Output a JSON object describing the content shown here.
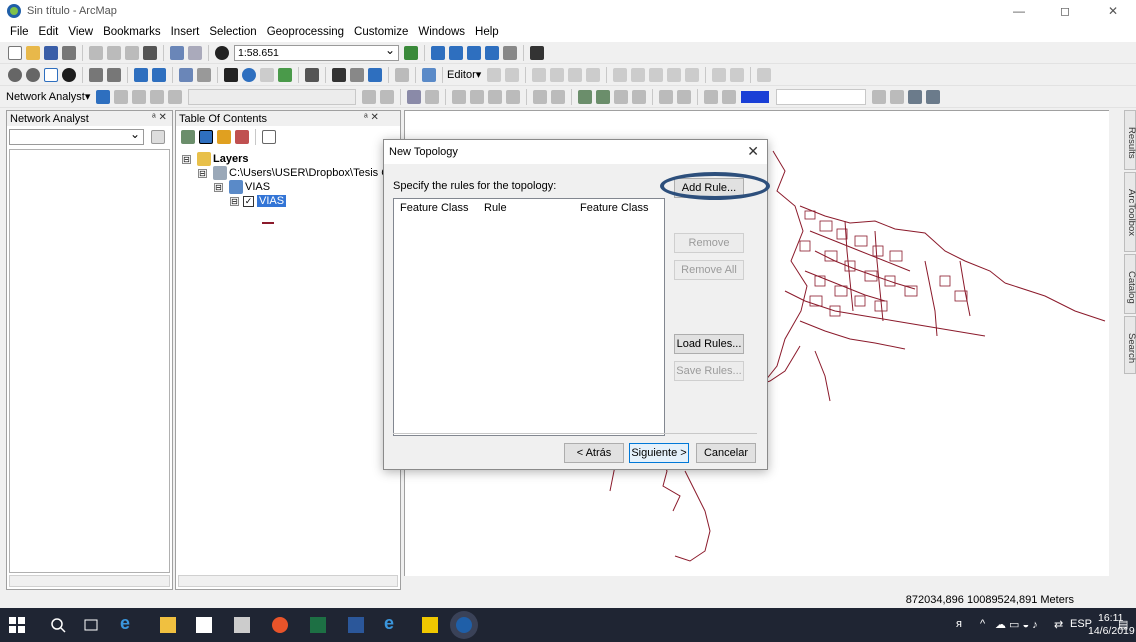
{
  "window": {
    "title": "Sin título - ArcMap",
    "controls": [
      "—",
      "◻",
      "✕"
    ]
  },
  "menu": [
    "File",
    "Edit",
    "View",
    "Bookmarks",
    "Insert",
    "Selection",
    "Geoprocessing",
    "Customize",
    "Windows",
    "Help"
  ],
  "toolbar": {
    "scale_value": "1:58.651",
    "editor_label": "Editor▾",
    "network_analyst_label": "Network Analyst▾"
  },
  "network_analyst_panel": {
    "title": "Network Analyst",
    "pin": "ᵃ ✕"
  },
  "toc": {
    "title": "Table Of Contents",
    "pin": "ᵃ ✕",
    "items": [
      {
        "label": "Layers",
        "expander": "⊟"
      },
      {
        "label": "C:\\Users\\USER\\Dropbox\\Tesis Casc",
        "expander": "⊟"
      },
      {
        "label": "VIAS",
        "expander": "⊟"
      },
      {
        "label": "VIAS",
        "expander": "⊟",
        "checked": "✓"
      }
    ]
  },
  "side_tabs": [
    "Results",
    "ArcToolbox",
    "Catalog",
    "Search"
  ],
  "dialog": {
    "title": "New Topology",
    "instruction": "Specify the rules for the topology:",
    "columns": [
      "Feature Class",
      "Rule",
      "Feature Class"
    ],
    "buttons": {
      "add_rule": "Add Rule...",
      "remove": "Remove",
      "remove_all": "Remove All",
      "load_rules": "Load Rules...",
      "save_rules": "Save Rules...",
      "back": "< Atrás",
      "next": "Siguiente >",
      "cancel": "Cancelar"
    }
  },
  "status": {
    "coordinates": "872034,896  10089524,891 Meters"
  },
  "taskbar": {
    "lang": "ESP",
    "time": "16:11",
    "date": "14/6/2019"
  },
  "colors": {
    "map_lines": "#8b1a2b",
    "highlight_ring": "#2d4f7c",
    "taskbar": "#1f2533"
  }
}
